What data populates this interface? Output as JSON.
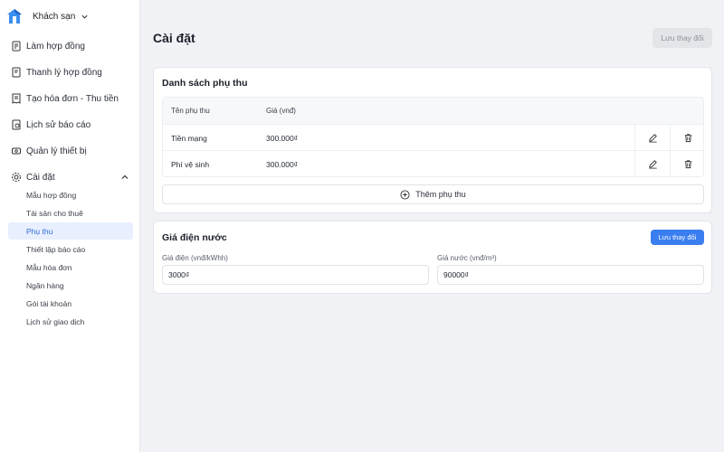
{
  "sidebar": {
    "brand": "Khách sạn",
    "items": [
      {
        "label": "Làm hợp đồng",
        "icon": "contract-icon"
      },
      {
        "label": "Thanh lý hợp đồng",
        "icon": "document-icon"
      },
      {
        "label": "Tạo hóa đơn - Thu tiền",
        "icon": "invoice-icon"
      },
      {
        "label": "Lịch sử báo cáo",
        "icon": "report-history-icon"
      },
      {
        "label": "Quản lý thiết bị",
        "icon": "device-icon"
      },
      {
        "label": "Cài đặt",
        "icon": "gear-icon"
      }
    ],
    "sub_items": [
      {
        "label": "Mẫu hợp đồng"
      },
      {
        "label": "Tài sản cho thuê"
      },
      {
        "label": "Phụ thu"
      },
      {
        "label": "Thiết lập báo cáo"
      },
      {
        "label": "Mẫu hóa đơn"
      },
      {
        "label": "Ngân hàng"
      },
      {
        "label": "Gói tài khoản"
      },
      {
        "label": "Lịch sử giao dịch"
      }
    ]
  },
  "header": {
    "title": "Cài đặt",
    "save_label": "Lưu thay đổi"
  },
  "surcharges": {
    "title": "Danh sách phụ thu",
    "col_name": "Tên phụ thu",
    "col_price": "Giá (vnđ)",
    "rows": [
      {
        "name": "Tiền mạng",
        "price": "300.000₫"
      },
      {
        "name": "Phí vệ sinh",
        "price": "300.000₫"
      }
    ],
    "add_label": "Thêm phụ thu"
  },
  "utilities": {
    "title": "Giá điện nước",
    "save_label": "Lưu thay đổi",
    "electric_label": "Giá điện (vnđ/kWhh)",
    "electric_value": "3000₫",
    "water_label": "Giá nước (vnđ/m³)",
    "water_value": "90000₫"
  },
  "colors": {
    "accent": "#3a7ef0",
    "active_bg": "#e8efff",
    "page_bg": "#f1f2f6"
  }
}
